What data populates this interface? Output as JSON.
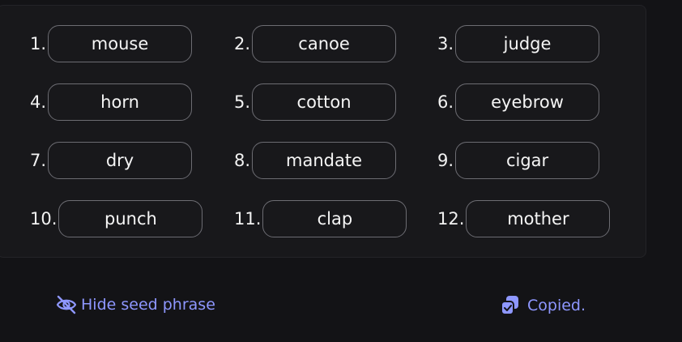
{
  "seed_words": [
    {
      "index": "1.",
      "word": "mouse"
    },
    {
      "index": "2.",
      "word": "canoe"
    },
    {
      "index": "3.",
      "word": "judge"
    },
    {
      "index": "4.",
      "word": "horn"
    },
    {
      "index": "5.",
      "word": "cotton"
    },
    {
      "index": "6.",
      "word": "eyebrow"
    },
    {
      "index": "7.",
      "word": "dry"
    },
    {
      "index": "8.",
      "word": "mandate"
    },
    {
      "index": "9.",
      "word": "cigar"
    },
    {
      "index": "10.",
      "word": "punch"
    },
    {
      "index": "11.",
      "word": "clap"
    },
    {
      "index": "12.",
      "word": "mother"
    }
  ],
  "actions": {
    "hide_label": "Hide seed phrase",
    "copy_label": "Copied."
  },
  "colors": {
    "accent": "#8e97ff",
    "background": "#131316",
    "panel": "#18181b",
    "pill_border": "#6c6c72"
  },
  "icons": {
    "hide": "eye-off-icon",
    "copy": "copy-icon"
  }
}
